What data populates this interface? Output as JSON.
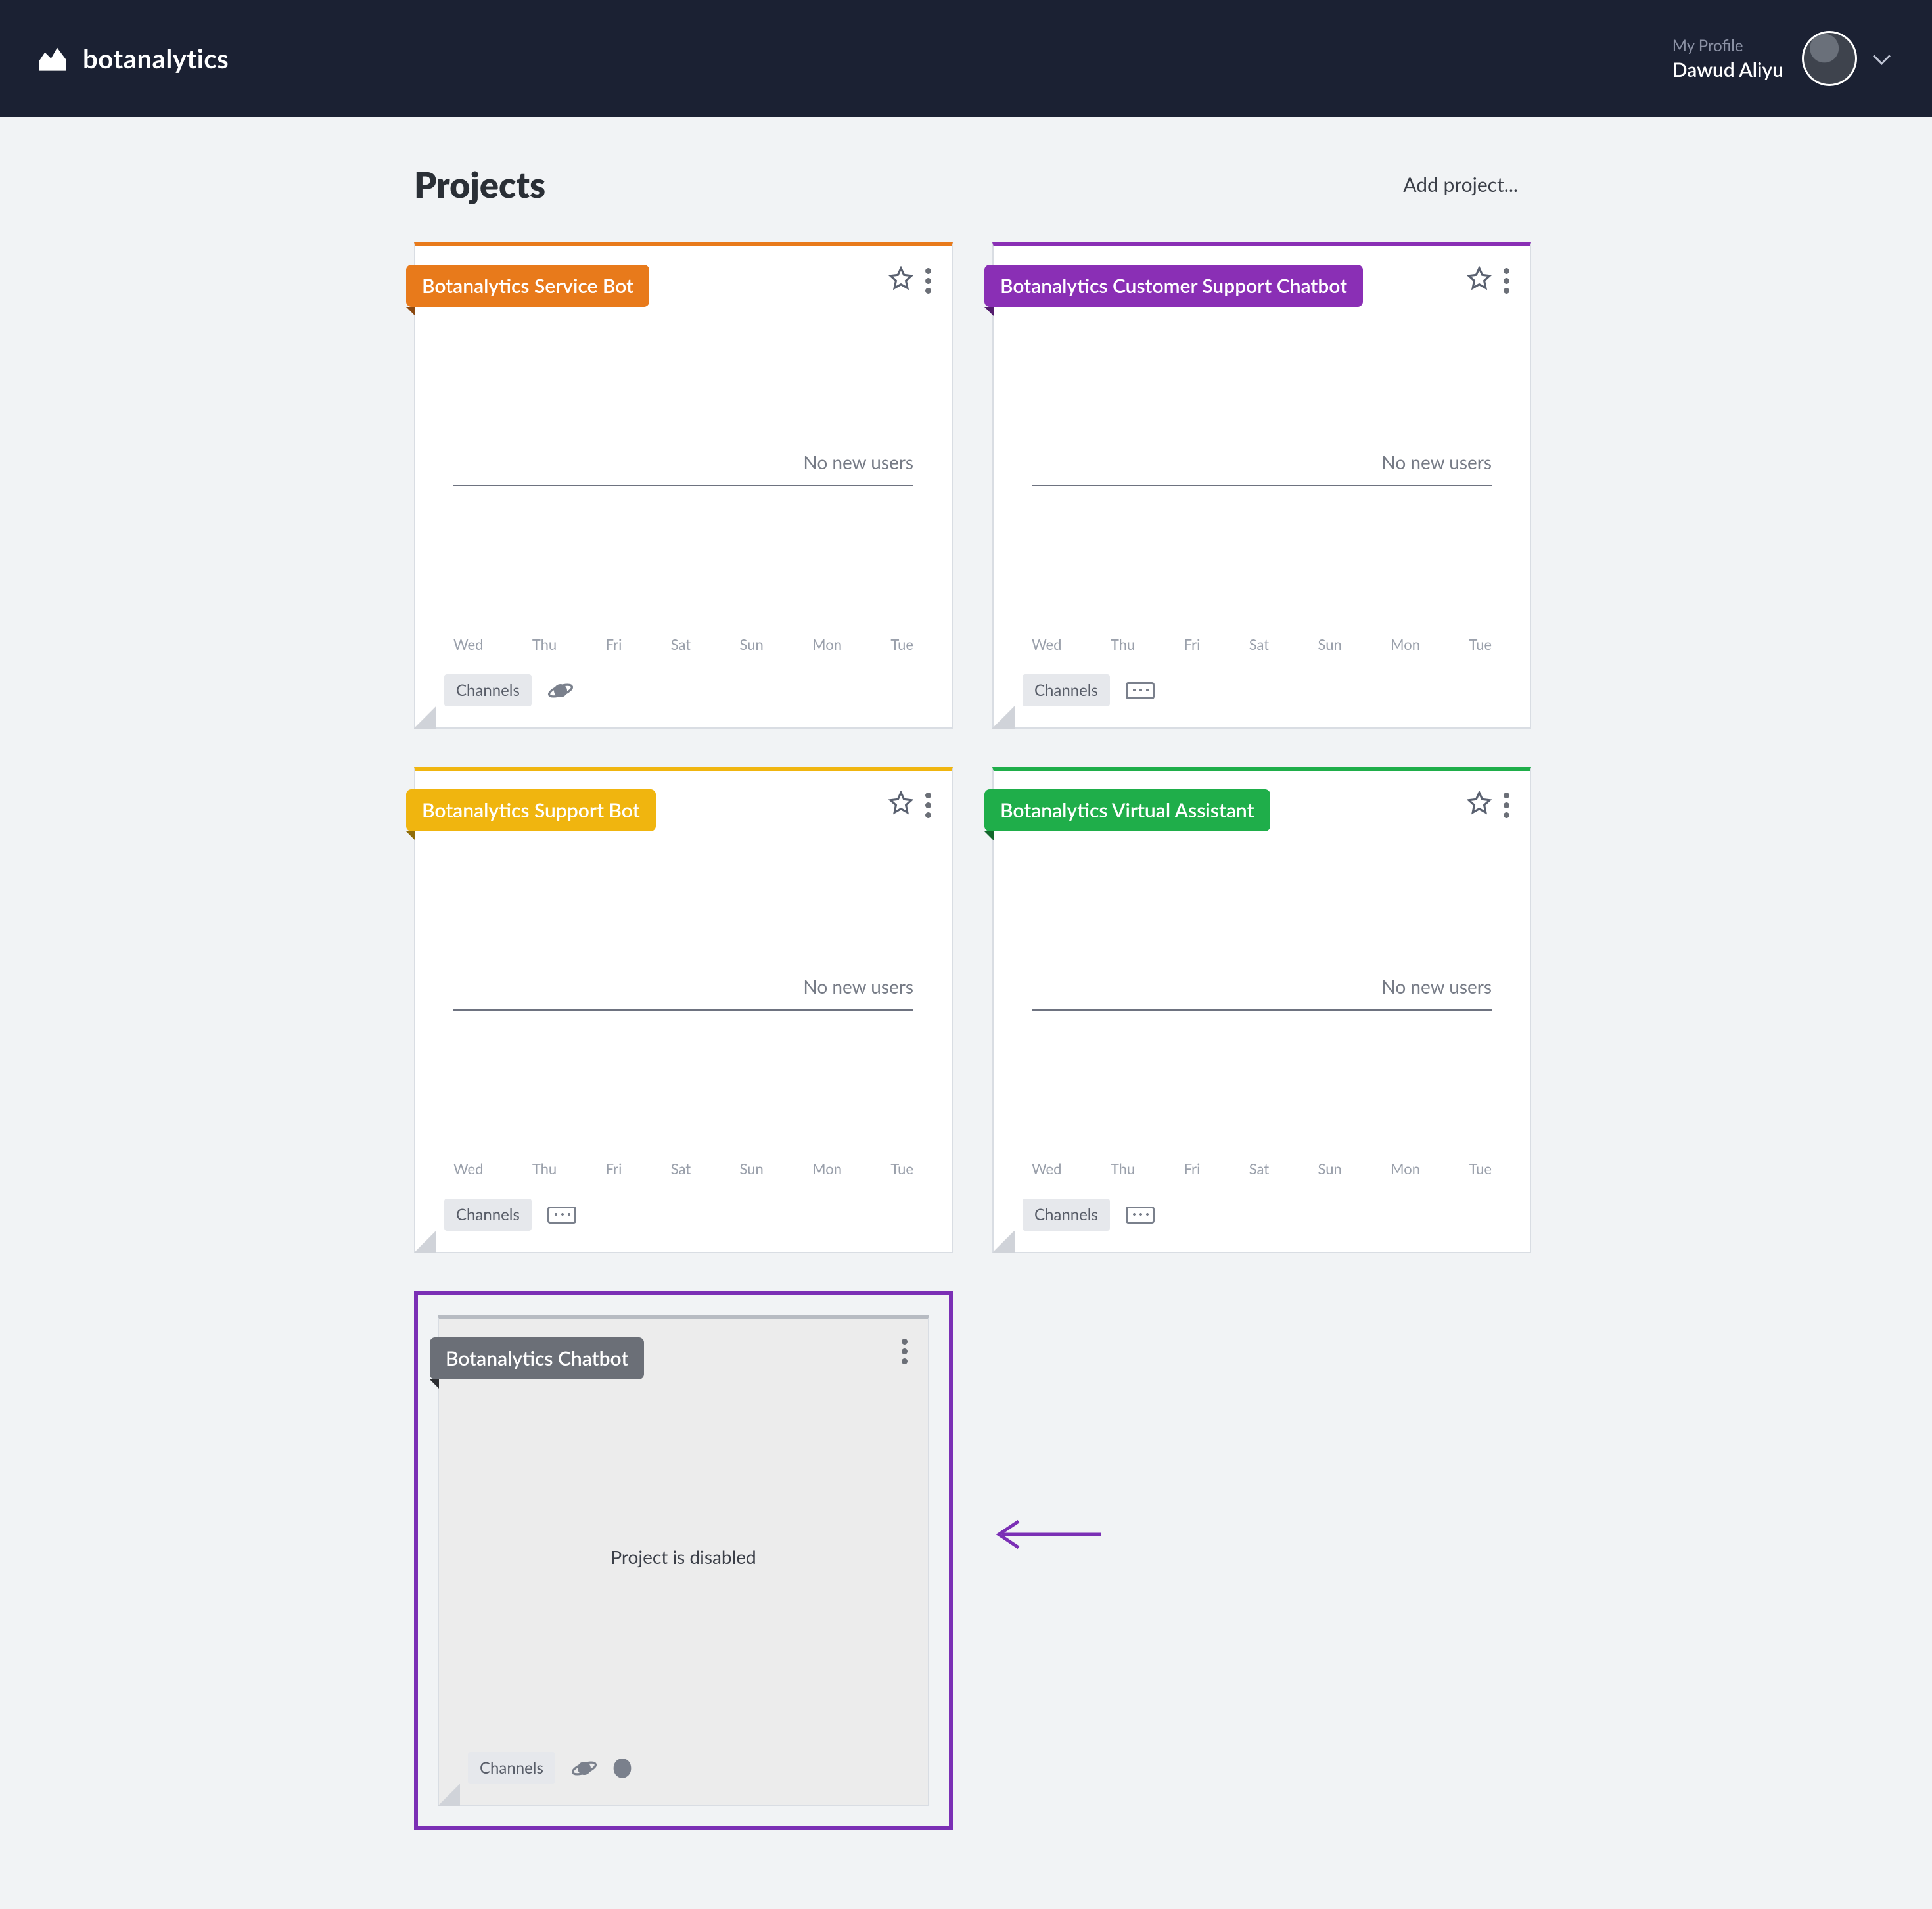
{
  "header": {
    "brand": "botanalytics",
    "profile_label": "My Profile",
    "profile_name": "Dawud Aliyu"
  },
  "page": {
    "title": "Projects",
    "add_label": "Add project..."
  },
  "chart_axis": [
    "Wed",
    "Thu",
    "Fri",
    "Sat",
    "Sun",
    "Mon",
    "Tue"
  ],
  "labels": {
    "no_new_users": "No new users",
    "channels": "Channels",
    "project_disabled": "Project is disabled"
  },
  "projects": [
    {
      "name": "Botanalytics Service Bot",
      "accent": "#e87a1b",
      "status": "no_users",
      "starred": false,
      "channels": [
        "planet"
      ]
    },
    {
      "name": "Botanalytics Customer Support Chatbot",
      "accent": "#8a2fb5",
      "status": "no_users",
      "starred": false,
      "channels": [
        "keyboard"
      ]
    },
    {
      "name": "Botanalytics Support Bot",
      "accent": "#f0b50f",
      "status": "no_users",
      "starred": false,
      "channels": [
        "keyboard"
      ]
    },
    {
      "name": "Botanalytics Virtual Assistant",
      "accent": "#1fae4a",
      "status": "no_users",
      "starred": false,
      "channels": [
        "keyboard"
      ]
    },
    {
      "name": "Botanalytics Chatbot",
      "accent": "#6b6f77",
      "status": "disabled",
      "starred": false,
      "channels": [
        "planet",
        "blob"
      ],
      "highlighted": true
    }
  ]
}
